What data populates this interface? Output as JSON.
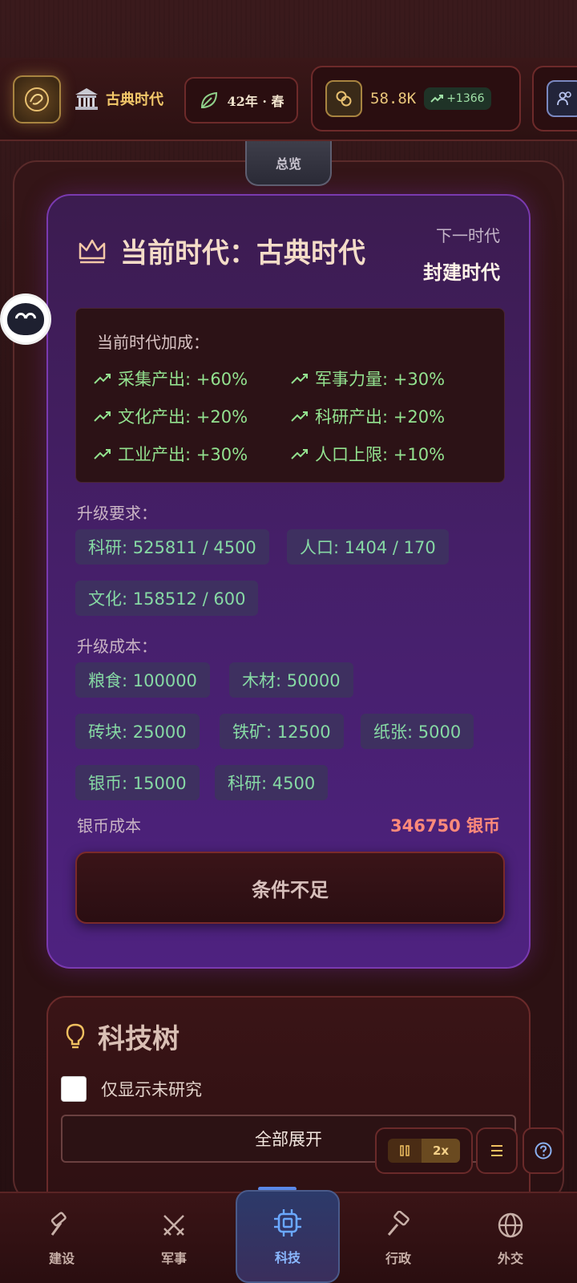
{
  "topbar": {
    "era_name": "古典时代",
    "year": "42年 · 春",
    "coins": "58.8K",
    "coins_delta": "+1366"
  },
  "overview_tab": "总览",
  "era_card": {
    "title": "当前时代：古典时代",
    "next_label": "下一时代",
    "next_value": "封建时代",
    "bonus_title": "当前时代加成：",
    "bonuses": [
      {
        "label": "采集产出: +60%"
      },
      {
        "label": "军事力量: +30%"
      },
      {
        "label": "文化产出: +20%"
      },
      {
        "label": "科研产出: +20%"
      },
      {
        "label": "工业产出: +30%"
      },
      {
        "label": "人口上限: +10%"
      }
    ],
    "requirements_label": "升级要求：",
    "requirements": [
      "科研: 525811 / 4500",
      "人口: 1404 / 170",
      "文化: 158512 / 600"
    ],
    "cost_label": "升级成本：",
    "costs": [
      "粮食: 100000",
      "木材: 50000",
      "砖块: 25000",
      "铁矿: 12500",
      "纸张: 5000",
      "银币: 15000",
      "科研: 4500"
    ],
    "silver_cost_label": "银币成本",
    "silver_cost_value": "346750 银币",
    "button_label": "条件不足"
  },
  "tech_card": {
    "title": "科技树",
    "checkbox_label": "仅显示未研究",
    "expand_label": "全部展开"
  },
  "controls": {
    "speed": "2x"
  },
  "nav": {
    "items": [
      {
        "label": "建设",
        "icon": "hammer-icon"
      },
      {
        "label": "军事",
        "icon": "swords-icon"
      },
      {
        "label": "科技",
        "icon": "chip-icon"
      },
      {
        "label": "行政",
        "icon": "gavel-icon"
      },
      {
        "label": "外交",
        "icon": "globe-icon"
      }
    ],
    "active_index": 2
  },
  "colors": {
    "accent_gold": "#f3c86a",
    "positive_green": "#93e28f",
    "cost_red": "#ff8a7a",
    "era_purple": "#4e2280",
    "active_nav_blue": "#8ab8ff"
  }
}
